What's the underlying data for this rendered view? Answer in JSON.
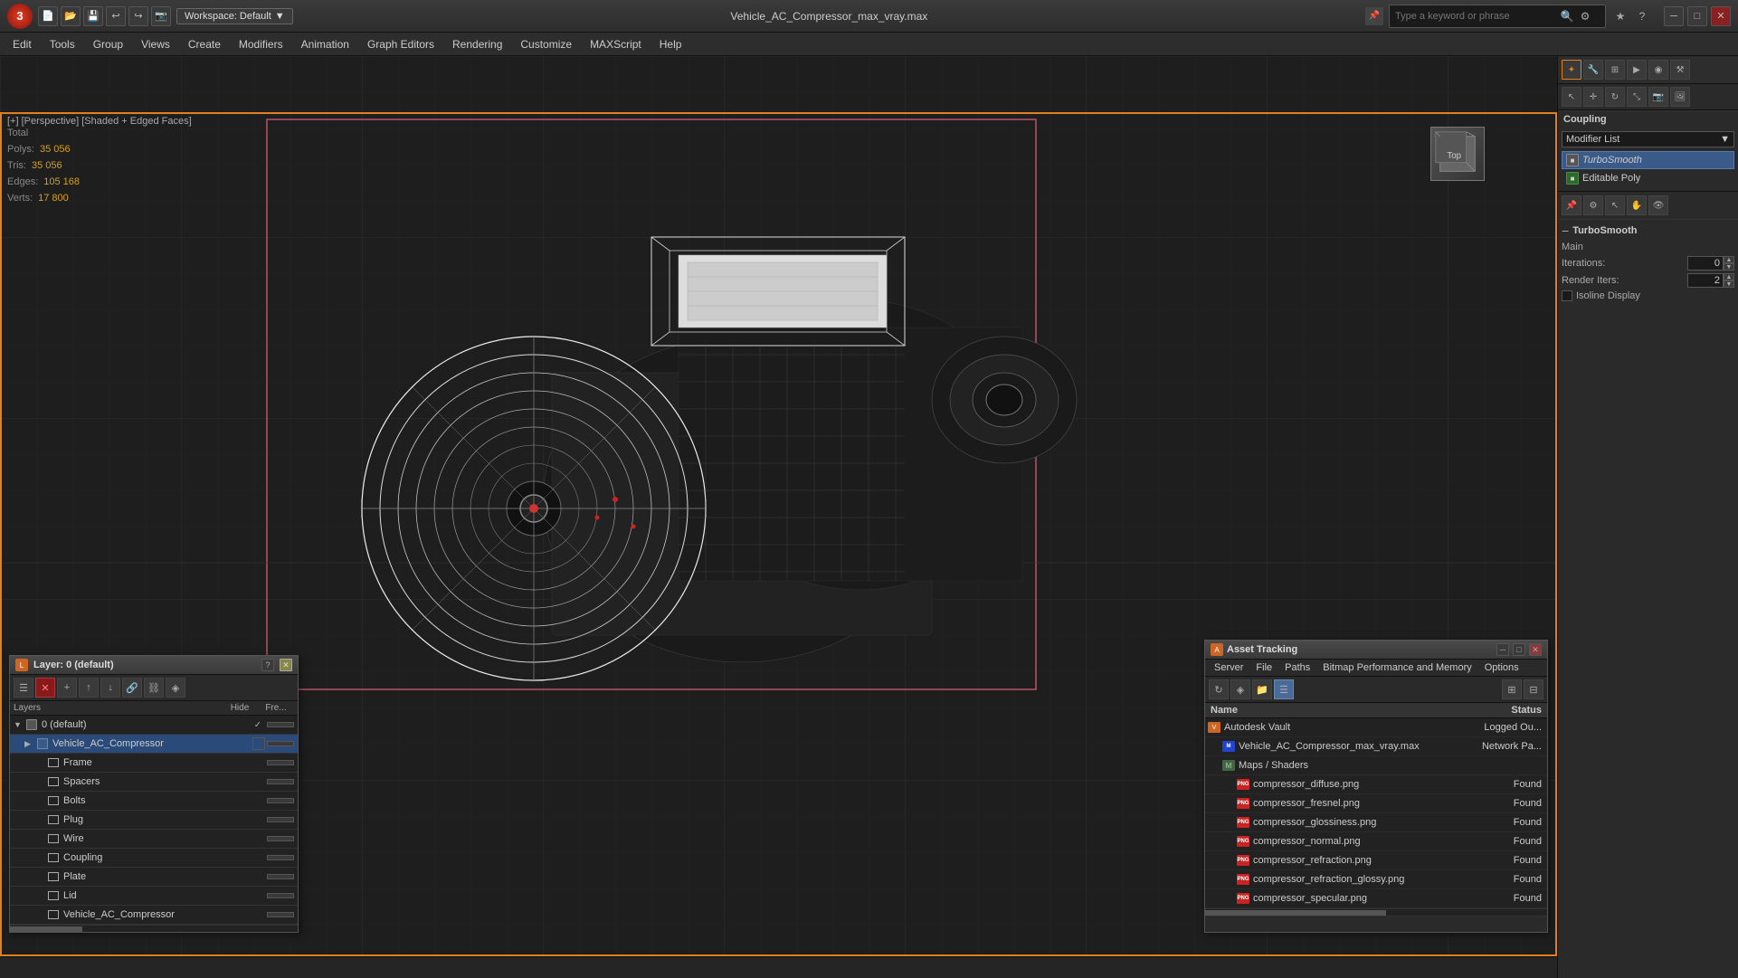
{
  "titlebar": {
    "logo": "3",
    "title": "Vehicle_AC_Compressor_max_vray.max",
    "workspace_label": "Workspace: Default",
    "search_placeholder": "Type a keyword or phrase"
  },
  "menubar": {
    "items": [
      "Edit",
      "Tools",
      "Group",
      "Views",
      "Create",
      "Modifiers",
      "Animation",
      "Graph Editors",
      "Rendering",
      "Customize",
      "MAXScript",
      "Help"
    ]
  },
  "viewport": {
    "label": "[+] [Perspective] [Shaded + Edged Faces]",
    "stats": {
      "total_label": "Total",
      "polys_label": "Polys:",
      "polys_value": "35 056",
      "tris_label": "Tris:",
      "tris_value": "35 056",
      "edges_label": "Edges:",
      "edges_value": "105 168",
      "verts_label": "Verts:",
      "verts_value": "17 800"
    }
  },
  "rightpanel": {
    "coupling_label": "Coupling",
    "modifier_list_label": "Modifier List",
    "modifiers": [
      {
        "name": "TurboSmooth",
        "type": "italic"
      },
      {
        "name": "Editable Poly",
        "type": "normal"
      }
    ],
    "turbosmooth": {
      "title": "TurboSmooth",
      "main_label": "Main",
      "iterations_label": "Iterations:",
      "iterations_value": "0",
      "render_iters_label": "Render Iters:",
      "render_iters_value": "2",
      "isoline_label": "Isoline Display"
    }
  },
  "layerpanel": {
    "title": "Layer: 0 (default)",
    "help_label": "?",
    "headers": {
      "name": "Layers",
      "hide": "Hide",
      "freeze": "Fre..."
    },
    "layers": [
      {
        "id": "default",
        "name": "0 (default)",
        "level": 0,
        "expand": true,
        "check": "✓",
        "selected": false
      },
      {
        "id": "compressor",
        "name": "Vehicle_AC_Compressor",
        "level": 1,
        "expand": false,
        "check": "",
        "selected": true
      },
      {
        "id": "frame",
        "name": "Frame",
        "level": 2,
        "expand": false,
        "check": "",
        "selected": false
      },
      {
        "id": "spacers",
        "name": "Spacers",
        "level": 2,
        "expand": false,
        "check": "",
        "selected": false
      },
      {
        "id": "bolts",
        "name": "Bolts",
        "level": 2,
        "expand": false,
        "check": "",
        "selected": false
      },
      {
        "id": "plug",
        "name": "Plug",
        "level": 2,
        "expand": false,
        "check": "",
        "selected": false
      },
      {
        "id": "wire",
        "name": "Wire",
        "level": 2,
        "expand": false,
        "check": "",
        "selected": false
      },
      {
        "id": "coupling",
        "name": "Coupling",
        "level": 2,
        "expand": false,
        "check": "",
        "selected": false
      },
      {
        "id": "plate",
        "name": "Plate",
        "level": 2,
        "expand": false,
        "check": "",
        "selected": false
      },
      {
        "id": "lid",
        "name": "Lid",
        "level": 2,
        "expand": false,
        "check": "",
        "selected": false
      },
      {
        "id": "vehicle_ac",
        "name": "Vehicle_AC_Compressor",
        "level": 2,
        "expand": false,
        "check": "",
        "selected": false
      }
    ]
  },
  "assetpanel": {
    "title": "Asset Tracking",
    "menu_items": [
      "Server",
      "File",
      "Paths",
      "Bitmap Performance and Memory",
      "Options"
    ],
    "headers": {
      "name": "Name",
      "status": "Status"
    },
    "assets": [
      {
        "id": "vault",
        "name": "Autodesk Vault",
        "status": "Logged Ou...",
        "level": "parent",
        "icon": "vault"
      },
      {
        "id": "maxfile",
        "name": "Vehicle_AC_Compressor_max_vray.max",
        "status": "Network Pa...",
        "level": "child",
        "icon": "max"
      },
      {
        "id": "maps",
        "name": "Maps / Shaders",
        "status": "",
        "level": "child",
        "icon": "folder"
      },
      {
        "id": "diffuse",
        "name": "compressor_diffuse.png",
        "status": "Found",
        "level": "grandchild",
        "icon": "png"
      },
      {
        "id": "fresnel",
        "name": "compressor_fresnel.png",
        "status": "Found",
        "level": "grandchild",
        "icon": "png"
      },
      {
        "id": "glossiness",
        "name": "compressor_glossiness.png",
        "status": "Found",
        "level": "grandchild",
        "icon": "png"
      },
      {
        "id": "normal",
        "name": "compressor_normal.png",
        "status": "Found",
        "level": "grandchild",
        "icon": "png"
      },
      {
        "id": "refraction",
        "name": "compressor_refraction.png",
        "status": "Found",
        "level": "grandchild",
        "icon": "png"
      },
      {
        "id": "refraction_glossy",
        "name": "compressor_refraction_glossy.png",
        "status": "Found",
        "level": "grandchild",
        "icon": "png"
      },
      {
        "id": "specular",
        "name": "compressor_specular.png",
        "status": "Found",
        "level": "grandchild",
        "icon": "png"
      }
    ]
  },
  "statusbar": {
    "text": ""
  }
}
